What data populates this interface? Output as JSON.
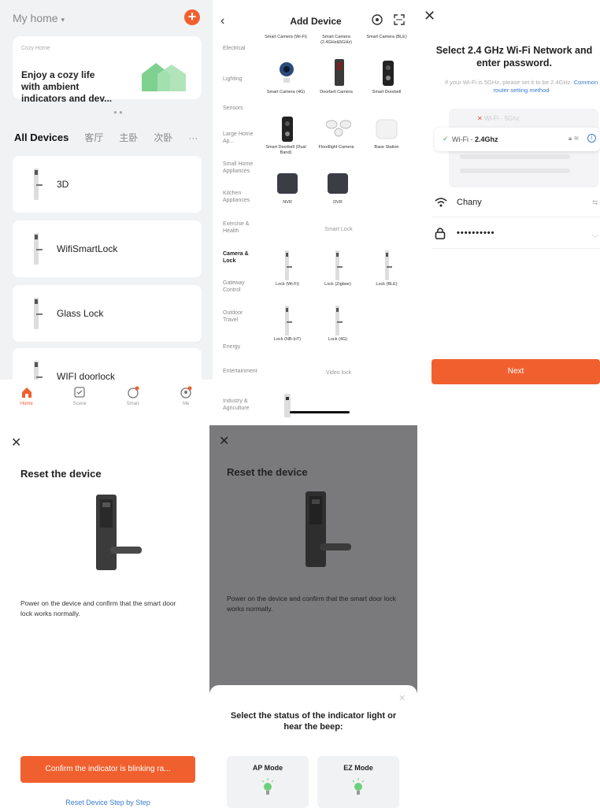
{
  "home": {
    "title": "My home",
    "banner_tag": "Cozy Home",
    "banner_text": "Enjoy a cozy life with ambient indicators and dev...",
    "tabs": [
      "All Devices",
      "客厅",
      "主卧",
      "次卧",
      "···"
    ],
    "devices": [
      "3D",
      "WifiSmartLock",
      "Glass Lock",
      "WIFI doorlock"
    ],
    "tabbar": [
      "Home",
      "Scene",
      "Smart",
      "Me"
    ],
    "accent": "#f0602f"
  },
  "add_device": {
    "title": "Add Device",
    "categories": [
      "Electrical",
      "Lighting",
      "Sensors",
      "Large Home Ap...",
      "Small Home Appliances",
      "Kitchen Appliances",
      "Exercise & Health",
      "Camera & Lock",
      "Gateway Control",
      "Outdoor Travel",
      "Energy",
      "Entertainment",
      "Industry & Agriculture"
    ],
    "selected_category": "Camera & Lock",
    "top_labels": [
      "Smart Camera (Wi-Fi)",
      "Smart Camera (2.4GHz&5GHz)",
      "Smart Camera (BLE)"
    ],
    "row2": [
      "Smart Camera (4G)",
      "Doorbell Camera",
      "Smart Doorbell"
    ],
    "row3": [
      "Smart Doorbell (Dual Band)",
      "Floodlight Camera",
      "Base Station"
    ],
    "row4": [
      "NVR",
      "DVR"
    ],
    "section_lock": "Smart Lock",
    "locks1": [
      "Lock (Wi-Fi)",
      "Lock (Zigbee)",
      "Lock (BLE)"
    ],
    "locks2": [
      "Lock (NB-IoT)",
      "Lock (4G)"
    ],
    "section_video": "Video lock"
  },
  "wifi": {
    "title": "Select 2.4 GHz Wi-Fi Network and enter password.",
    "hint": "If your Wi-Fi is 5GHz, please set it to be 2.4GHz.",
    "hint_link": "Common router setting method",
    "bad_network": "Wi-Fi - 5Ghz",
    "good_network_prefix": "Wi-Fi - ",
    "good_network_bold": "2.4Ghz",
    "ssid": "Chany",
    "password": "••••••••••",
    "next": "Next"
  },
  "reset": {
    "title": "Reset the device",
    "description": "Power on the device and confirm that the smart door lock works normally.",
    "confirm": "Confirm the indicator is blinking ra...",
    "step_link": "Reset Device Step by Step"
  },
  "indicator": {
    "title": "Reset the device",
    "description": "Power on the device and confirm that the smart door lock works normally.",
    "sheet_title": "Select the status of the indicator light or hear the beep:",
    "modes": [
      "AP Mode",
      "EZ Mode"
    ]
  }
}
